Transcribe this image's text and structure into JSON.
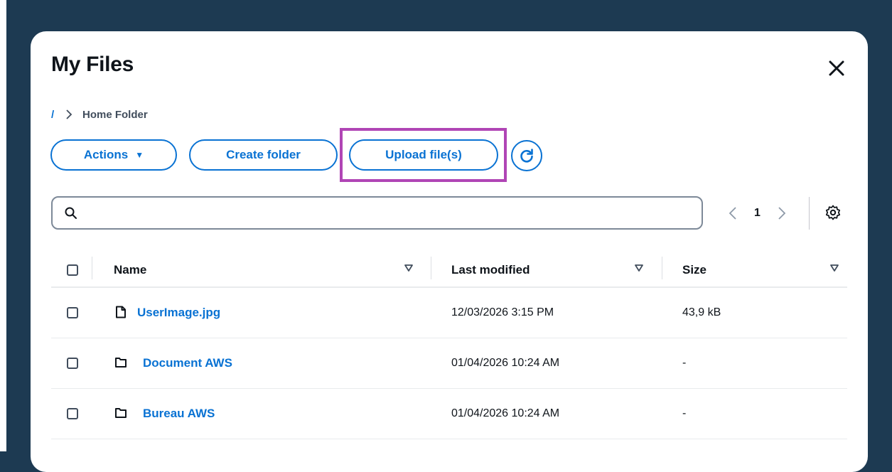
{
  "modal": {
    "title": "My Files",
    "close_icon": "close-icon"
  },
  "breadcrumb": {
    "root": "/",
    "separator_icon": "chevron-right-icon",
    "current": "Home Folder"
  },
  "toolbar": {
    "actions_label": "Actions",
    "actions_caret": "▼",
    "create_folder_label": "Create folder",
    "upload_label": "Upload file(s)",
    "refresh_icon": "refresh-icon"
  },
  "search": {
    "placeholder": "",
    "value": "",
    "icon": "search-icon"
  },
  "pagination": {
    "current_page": "1",
    "prev_icon": "chevron-left-icon",
    "next_icon": "chevron-right-icon",
    "settings_icon": "gear-icon"
  },
  "table": {
    "columns": {
      "name": "Name",
      "last_modified": "Last modified",
      "size": "Size"
    },
    "sort_icon": "sort-down-icon",
    "rows": [
      {
        "type": "file",
        "icon": "file-icon",
        "name": "UserImage.jpg",
        "last_modified": "12/03/2026 3:15 PM",
        "size": "43,9 kB"
      },
      {
        "type": "folder",
        "icon": "folder-icon",
        "name": "Document AWS",
        "last_modified": "01/04/2026 10:24 AM",
        "size": "-"
      },
      {
        "type": "folder",
        "icon": "folder-icon",
        "name": "Bureau AWS",
        "last_modified": "01/04/2026 10:24 AM",
        "size": "-"
      }
    ]
  },
  "colors": {
    "backdrop": "#1d3a52",
    "accent": "#0972d3",
    "highlight": "#b045b5",
    "text": "#0f141a"
  }
}
